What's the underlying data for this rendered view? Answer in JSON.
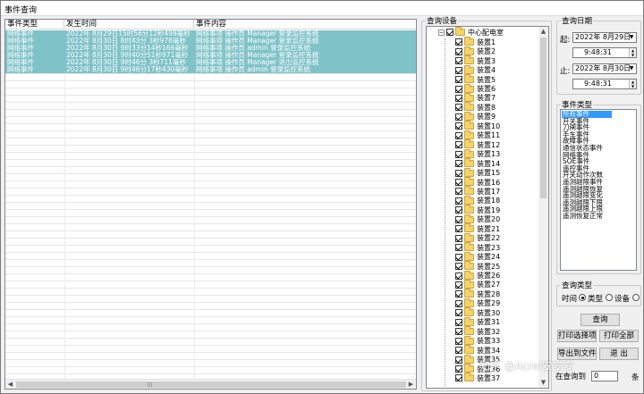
{
  "window": {
    "title": "事件查询"
  },
  "table": {
    "columns": [
      "事件类型",
      "发生时间",
      "事件内容"
    ],
    "rows": [
      [
        "网络事件",
        "2022年 8月29日15时56分12秒498毫秒",
        "网络事项 操作员 Manager 登录监控系统"
      ],
      [
        "网络事件",
        "2022年 8月30日 8时43分 3秒978毫秒",
        "网络事项 操作员 Manager 登录监控系统"
      ],
      [
        "网络事件",
        "2022年 8月30日 9时33分14秒166毫秒",
        "网络事项 操作员 admin 登录监控系统"
      ],
      [
        "网络事件",
        "2022年 8月30日 9时40分51秒971毫秒",
        "网络事项 操作员 Manager 登录监控系统"
      ],
      [
        "网络事件",
        "2022年 8月30日 9时46分 3秒711毫秒",
        "网络事项 操作员 Manager 退出监控系统"
      ],
      [
        "网络事件",
        "2022年 8月30日 9时46分17秒430毫秒",
        "网络事项 操作员 admin 登录监控系统"
      ]
    ],
    "scroll_grip": "|||"
  },
  "devices": {
    "legend": "查询设备",
    "root": "中心配电室",
    "expander_root": "−",
    "items": [
      "装置1",
      "装置2",
      "装置3",
      "装置4",
      "装置5",
      "装置6",
      "装置7",
      "装置8",
      "装置9",
      "装置10",
      "装置11",
      "装置12",
      "装置13",
      "装置14",
      "装置15",
      "装置16",
      "装置17",
      "装置18",
      "装置19",
      "装置20",
      "装置21",
      "装置22",
      "装置23",
      "装置24",
      "装置25",
      "装置26",
      "装置27",
      "装置28",
      "装置29",
      "装置30",
      "装置31",
      "装置32",
      "装置33",
      "装置34",
      "装置35",
      "装置36",
      "装置37"
    ]
  },
  "date": {
    "legend": "查询日期",
    "from_label": "起:",
    "from_date": "2022年 8月29日",
    "from_time": "9:48:31",
    "to_label": "止:",
    "to_date": "2022年 8月30日",
    "to_time": "9:48:31"
  },
  "event_types": {
    "legend": "事件类型",
    "items": [
      "所有事件",
      "开关事件",
      "刀闸事件",
      "手车事件",
      "故障事件",
      "通信状态事件",
      "网络事件",
      "SOE事件",
      "遥控事件",
      "开关动作次数",
      "遥测越限事件",
      "遥测越限恢复",
      "遥测越限变化",
      "遥测越限下限",
      "遥测越限上限",
      "遥测恢复正常"
    ],
    "selected": "所有事件"
  },
  "query_type": {
    "legend": "查询类型",
    "label": "时间",
    "options": [
      "类型",
      "设备"
    ],
    "selected": "类型"
  },
  "buttons": {
    "query": "查询",
    "print_selected": "打印选择项",
    "print_all": "打印全部",
    "export": "导出到文件",
    "exit": "退 出"
  },
  "condition": {
    "label": "在查询到",
    "value": "0",
    "unit": "条"
  },
  "watermark": "知乎 @Acrel安安安"
}
